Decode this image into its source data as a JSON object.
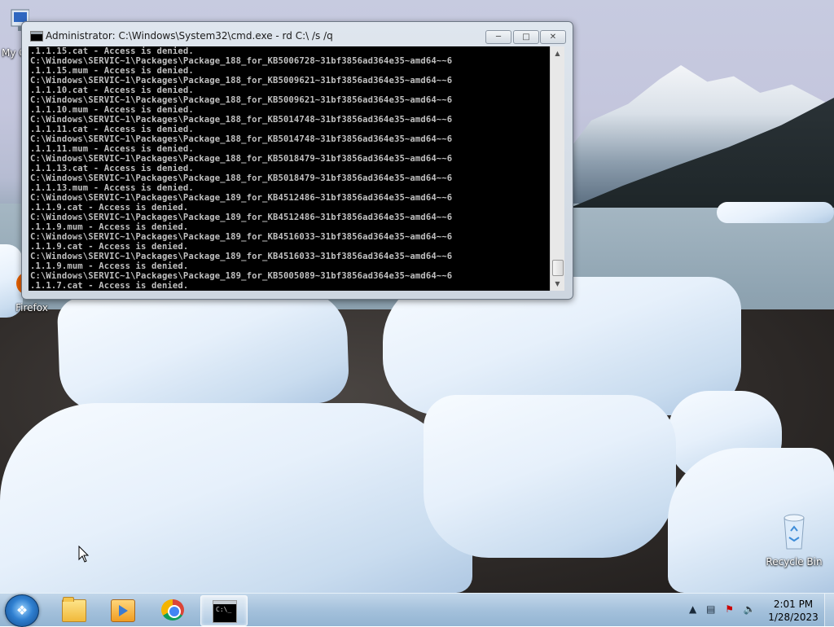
{
  "window": {
    "title": "Administrator: C:\\Windows\\System32\\cmd.exe - rd  C:\\ /s /q",
    "console_lines": [
      ".1.1.15.cat - Access is denied.",
      "C:\\Windows\\SERVIC~1\\Packages\\Package_188_for_KB5006728~31bf3856ad364e35~amd64~~6",
      ".1.1.15.mum - Access is denied.",
      "C:\\Windows\\SERVIC~1\\Packages\\Package_188_for_KB5009621~31bf3856ad364e35~amd64~~6",
      ".1.1.10.cat - Access is denied.",
      "C:\\Windows\\SERVIC~1\\Packages\\Package_188_for_KB5009621~31bf3856ad364e35~amd64~~6",
      ".1.1.10.mum - Access is denied.",
      "C:\\Windows\\SERVIC~1\\Packages\\Package_188_for_KB5014748~31bf3856ad364e35~amd64~~6",
      ".1.1.11.cat - Access is denied.",
      "C:\\Windows\\SERVIC~1\\Packages\\Package_188_for_KB5014748~31bf3856ad364e35~amd64~~6",
      ".1.1.11.mum - Access is denied.",
      "C:\\Windows\\SERVIC~1\\Packages\\Package_188_for_KB5018479~31bf3856ad364e35~amd64~~6",
      ".1.1.13.cat - Access is denied.",
      "C:\\Windows\\SERVIC~1\\Packages\\Package_188_for_KB5018479~31bf3856ad364e35~amd64~~6",
      ".1.1.13.mum - Access is denied.",
      "C:\\Windows\\SERVIC~1\\Packages\\Package_189_for_KB4512486~31bf3856ad364e35~amd64~~6",
      ".1.1.9.cat - Access is denied.",
      "C:\\Windows\\SERVIC~1\\Packages\\Package_189_for_KB4512486~31bf3856ad364e35~amd64~~6",
      ".1.1.9.mum - Access is denied.",
      "C:\\Windows\\SERVIC~1\\Packages\\Package_189_for_KB4516033~31bf3856ad364e35~amd64~~6",
      ".1.1.9.cat - Access is denied.",
      "C:\\Windows\\SERVIC~1\\Packages\\Package_189_for_KB4516033~31bf3856ad364e35~amd64~~6",
      ".1.1.9.mum - Access is denied.",
      "C:\\Windows\\SERVIC~1\\Packages\\Package_189_for_KB5005089~31bf3856ad364e35~amd64~~6",
      ".1.1.7.cat - Access is denied."
    ],
    "buttons": {
      "minimize_icon": "minimize-icon",
      "maximize_icon": "maximize-icon",
      "close_icon": "close-icon"
    }
  },
  "desktop": {
    "icons": [
      {
        "name": "my-computer",
        "label": "My C"
      },
      {
        "name": "firefox",
        "label": "Firefox"
      },
      {
        "name": "recycle-bin",
        "label": "Recycle Bin"
      }
    ]
  },
  "taskbar": {
    "start_icon": "windows-logo-icon",
    "pinned": [
      "explorer-icon",
      "media-player-icon",
      "chrome-icon",
      "cmd-icon"
    ],
    "active": "cmd",
    "tray_icons": [
      "show-hidden-icons-icon",
      "network-icon",
      "action-center-icon",
      "volume-icon"
    ],
    "clock": {
      "time": "2:01 PM",
      "date": "1/28/2023"
    }
  },
  "colors": {
    "console_bg": "#000000",
    "console_fg": "#c0c0c0",
    "taskbar": "#a9c5de"
  }
}
